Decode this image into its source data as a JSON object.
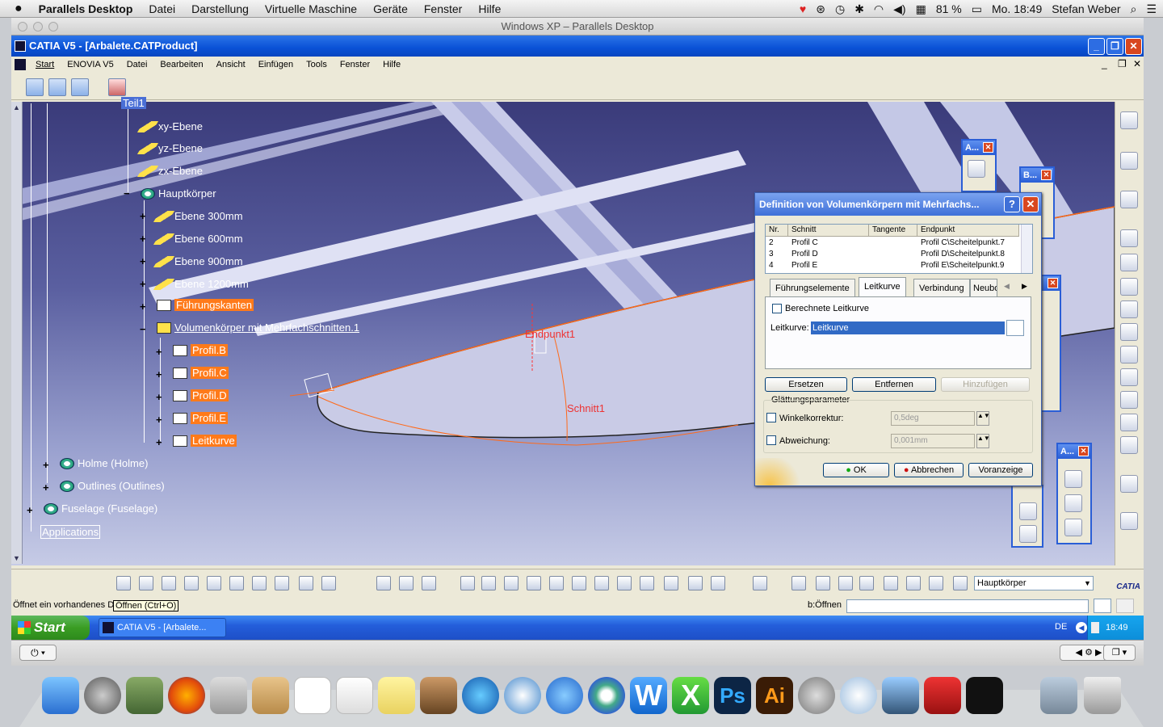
{
  "mac": {
    "app": "Parallels Desktop",
    "menus": [
      "Datei",
      "Darstellung",
      "Virtuelle Maschine",
      "Geräte",
      "Fenster",
      "Hilfe"
    ],
    "battery": "81 %",
    "clock": "Mo. 18:49",
    "user": "Stefan Weber"
  },
  "vm_title": "Windows XP – Parallels Desktop",
  "catia": {
    "title": "CATIA V5 - [Arbalete.CATProduct]",
    "menus": [
      "Start",
      "ENOVIA V5",
      "Datei",
      "Bearbeiten",
      "Ansicht",
      "Einfügen",
      "Tools",
      "Fenster",
      "Hilfe"
    ]
  },
  "tree": {
    "root_partial": "Teil1",
    "items": [
      {
        "label": "xy-Ebene",
        "icon": "plane"
      },
      {
        "label": "yz-Ebene",
        "icon": "plane"
      },
      {
        "label": "zx-Ebene",
        "icon": "plane"
      },
      {
        "label": "Hauptkörper",
        "icon": "gear"
      },
      {
        "label": "Ebene 300mm",
        "icon": "plane"
      },
      {
        "label": "Ebene 600mm",
        "icon": "plane"
      },
      {
        "label": "Ebene 900mm",
        "icon": "plane"
      },
      {
        "label": "Ebene 1200mm",
        "icon": "plane"
      },
      {
        "label": "Führungskanten",
        "icon": "sketch"
      },
      {
        "label": "Volumenkörper mit Mehrfachschnitten.1",
        "icon": "loft"
      },
      {
        "label": "Profil.B",
        "icon": "sketch"
      },
      {
        "label": "Profil.C",
        "icon": "sketch"
      },
      {
        "label": "Profil.D",
        "icon": "sketch"
      },
      {
        "label": "Profil.E",
        "icon": "sketch"
      },
      {
        "label": "Leitkurve",
        "icon": "sketch"
      },
      {
        "label": "Holme (Holme)",
        "icon": "product"
      },
      {
        "label": "Outlines (Outlines)",
        "icon": "product"
      },
      {
        "label": "Fuselage (Fuselage)",
        "icon": "product"
      },
      {
        "label": "Applications",
        "icon": "none"
      }
    ]
  },
  "viewport": {
    "label_endpunkt": "Endpunkt1",
    "label_schnitt": "Schnitt1"
  },
  "dialog": {
    "title": "Definition von Volumenkörpern mit Mehrfachs...",
    "columns": [
      "Nr.",
      "Schnitt",
      "Tangente",
      "Endpunkt"
    ],
    "rows": [
      {
        "nr": "2",
        "schnitt": "Profil C",
        "tangente": "",
        "endpunkt": "Profil C\\Scheitelpunkt.7"
      },
      {
        "nr": "3",
        "schnitt": "Profil D",
        "tangente": "",
        "endpunkt": "Profil D\\Scheitelpunkt.8"
      },
      {
        "nr": "4",
        "schnitt": "Profil E",
        "tangente": "",
        "endpunkt": "Profil E\\Scheitelpunkt.9"
      }
    ],
    "tabs": [
      "Führungselemente",
      "Leitkurve",
      "Verbindung",
      "Neubo"
    ],
    "active_tab": "Leitkurve",
    "checkbox_berechnete": "Berechnete Leitkurve",
    "leitkurve_label": "Leitkurve:",
    "leitkurve_value": "Leitkurve",
    "btn_ersetzen": "Ersetzen",
    "btn_entfernen": "Entfernen",
    "btn_hinzufuegen": "Hinzufügen",
    "group_glaettung": "Glättungsparameter",
    "winkel_label": "Winkelkorrektur:",
    "winkel_value": "0,5deg",
    "abw_label": "Abweichung:",
    "abw_value": "0,001mm",
    "ok": "OK",
    "abbrechen": "Abbrechen",
    "vorschau": "Voranzeige"
  },
  "mini_toolbars": {
    "a1": "A...",
    "b": "B...",
    "a2": "A..."
  },
  "bottom": {
    "dropdown": "Hauptkörper",
    "status_text": "Öffnet ein vorhandenes D",
    "tooltip": "Öffnen (Ctrl+O)",
    "command_label": "b:Öffnen",
    "command_value": ""
  },
  "taskbar": {
    "start": "Start",
    "task": "CATIA V5 - [Arbalete...",
    "lang": "DE",
    "time": "18:49"
  },
  "colors": {
    "xp_blue": "#0a51d6",
    "highlight_orange": "#ff7a1a",
    "catia_bg_top": "#3a3b7a"
  }
}
